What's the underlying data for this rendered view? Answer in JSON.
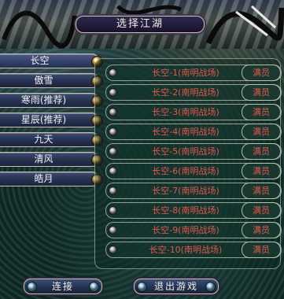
{
  "header": {
    "title": "选择江湖"
  },
  "realms": [
    {
      "label": "长空",
      "selected": true
    },
    {
      "label": "傲雪",
      "selected": false
    },
    {
      "label": "寒雨(推荐)",
      "selected": false
    },
    {
      "label": "星辰(推荐)",
      "selected": false
    },
    {
      "label": "九天",
      "selected": false
    },
    {
      "label": "清风",
      "selected": false
    },
    {
      "label": "皓月",
      "selected": false
    }
  ],
  "servers": [
    {
      "name": "长空-1(南明战场)",
      "status": "满员"
    },
    {
      "name": "长空-2(南明战场)",
      "status": "满员"
    },
    {
      "name": "长空-3(南明战场)",
      "status": "满员"
    },
    {
      "name": "长空-4(南明战场)",
      "status": "满员"
    },
    {
      "name": "长空-5(南明战场)",
      "status": "满员"
    },
    {
      "name": "长空-6(南明战场)",
      "status": "满员"
    },
    {
      "name": "长空-7(南明战场)",
      "status": "满员"
    },
    {
      "name": "长空-8(南明战场)",
      "status": "满员"
    },
    {
      "name": "长空-9(南明战场)",
      "status": "满员"
    },
    {
      "name": "长空-10(南明战场)",
      "status": "满员"
    }
  ],
  "buttons": {
    "connect": "连接",
    "exit": "退出游戏"
  },
  "colors": {
    "server_text": "#e0584e",
    "button_bg": "#26314f"
  }
}
